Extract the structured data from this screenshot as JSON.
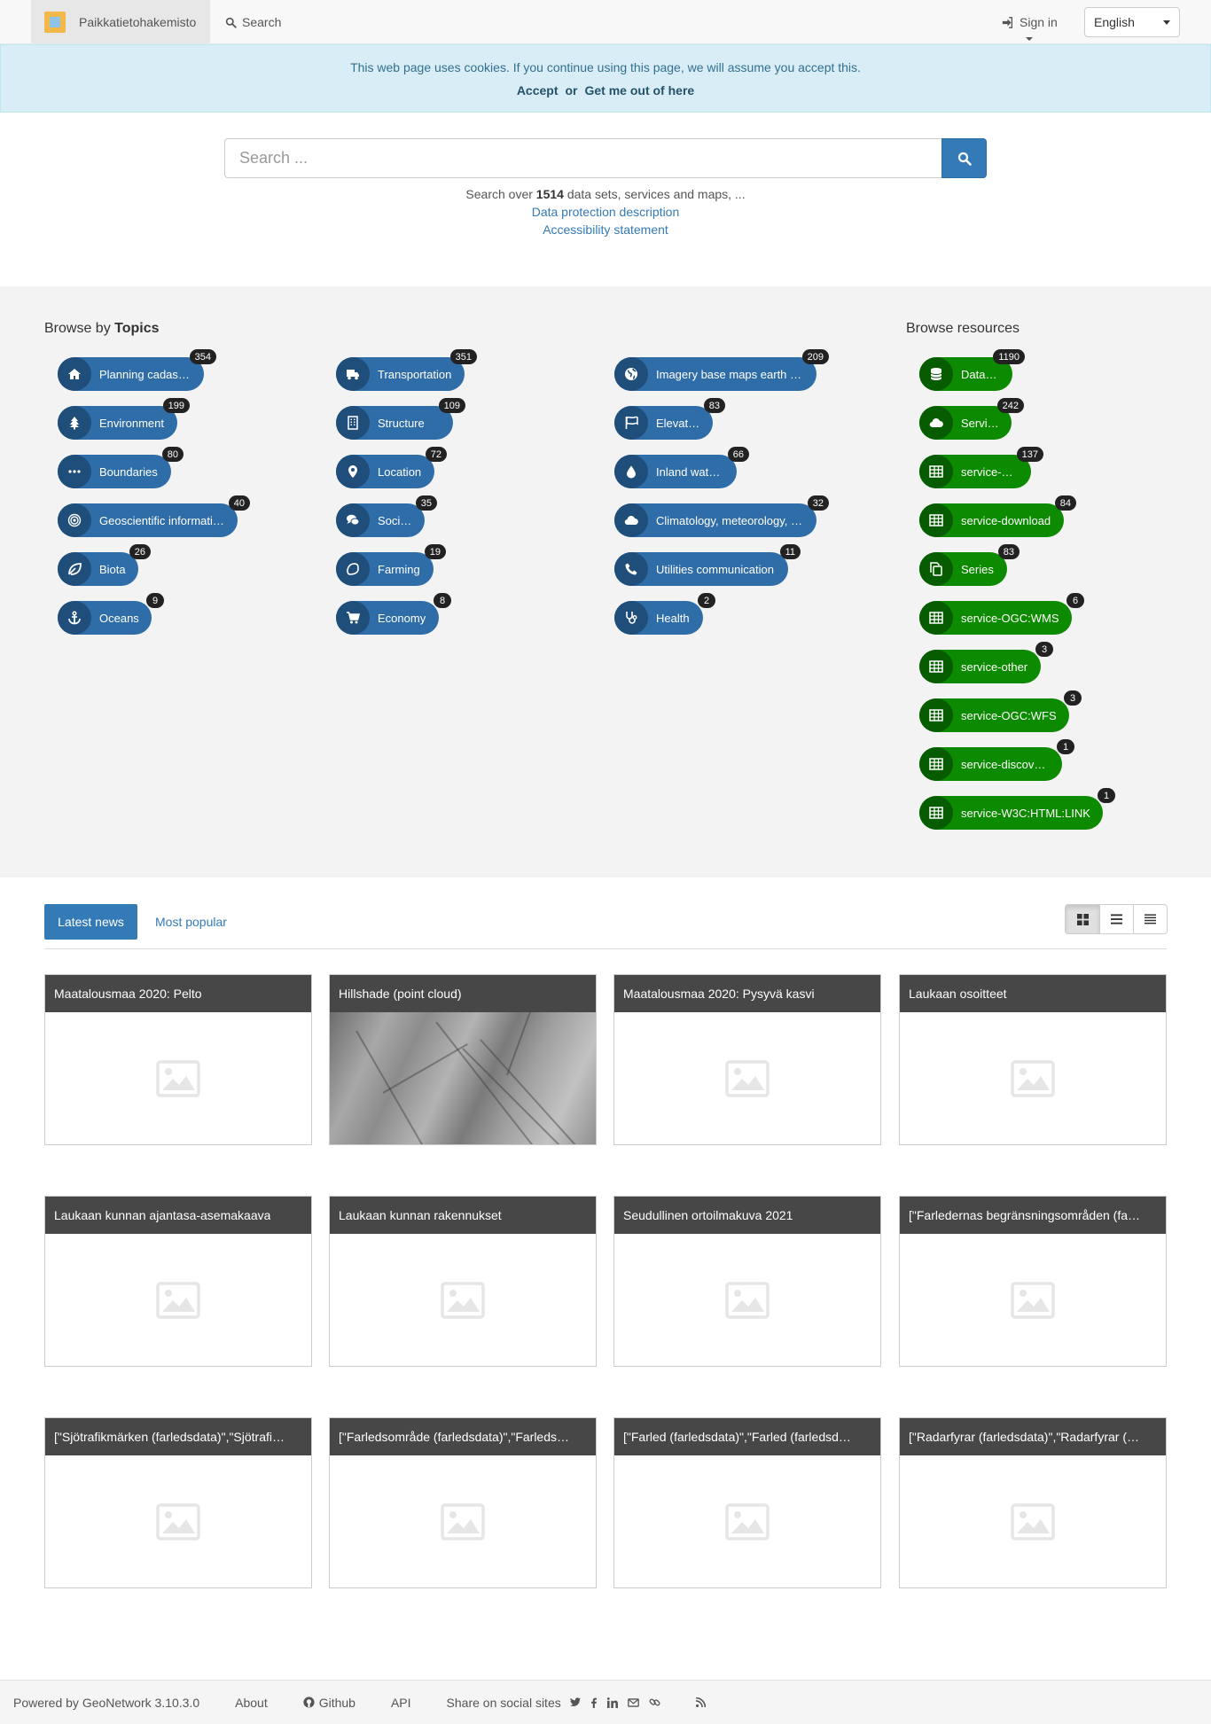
{
  "navbar": {
    "brand": "Paikkatietohakemisto",
    "search_label": "Search",
    "signin_label": "Sign in",
    "language": "English"
  },
  "cookie": {
    "message": "This web page uses cookies. If you continue using this page, we will assume you accept this.",
    "accept": "Accept",
    "or": "or",
    "reject": "Get me out of here"
  },
  "search": {
    "placeholder": "Search ...",
    "info_prefix": "Search over",
    "count": "1514",
    "info_suffix": "data sets, services and maps, ...",
    "data_protection": "Data protection description",
    "accessibility": "Accessibility statement"
  },
  "topics": {
    "title_prefix": "Browse by",
    "title_bold": "Topics",
    "items": [
      {
        "label": "Planning cadastre",
        "count": "354",
        "icon": "home-icon"
      },
      {
        "label": "Environment",
        "count": "199",
        "icon": "tree-icon"
      },
      {
        "label": "Boundaries",
        "count": "80",
        "icon": "ellipsis-icon"
      },
      {
        "label": "Geoscientific information",
        "count": "40",
        "icon": "target-icon"
      },
      {
        "label": "Biota",
        "count": "26",
        "icon": "leaf-icon"
      },
      {
        "label": "Oceans",
        "count": "9",
        "icon": "anchor-icon"
      },
      {
        "label": "Transportation",
        "count": "351",
        "icon": "truck-icon"
      },
      {
        "label": "Structure",
        "count": "109",
        "icon": "building-icon"
      },
      {
        "label": "Location",
        "count": "72",
        "icon": "map-marker-icon"
      },
      {
        "label": "Society",
        "count": "35",
        "icon": "comments-icon"
      },
      {
        "label": "Farming",
        "count": "19",
        "icon": "lemon-icon"
      },
      {
        "label": "Economy",
        "count": "8",
        "icon": "cart-icon"
      },
      {
        "label": "Imagery base maps earth …",
        "count": "209",
        "icon": "globe-icon"
      },
      {
        "label": "Elevation",
        "count": "83",
        "icon": "flag-icon"
      },
      {
        "label": "Inland waters",
        "count": "66",
        "icon": "drop-icon"
      },
      {
        "label": "Climatology, meteorology, …",
        "count": "32",
        "icon": "cloud-icon"
      },
      {
        "label": "Utilities communication",
        "count": "11",
        "icon": "phone-icon"
      },
      {
        "label": "Health",
        "count": "2",
        "icon": "stethoscope-icon"
      }
    ]
  },
  "resources": {
    "title": "Browse resources",
    "items": [
      {
        "label": "Dataset",
        "count": "1190",
        "icon": "database-icon"
      },
      {
        "label": "Service",
        "count": "242",
        "icon": "cloud-icon"
      },
      {
        "label": "service-view",
        "count": "137",
        "icon": "table-icon"
      },
      {
        "label": "service-download",
        "count": "84",
        "icon": "table-icon"
      },
      {
        "label": "Series",
        "count": "83",
        "icon": "copy-icon"
      },
      {
        "label": "service-OGC:WMS",
        "count": "6",
        "icon": "table-icon"
      },
      {
        "label": "service-other",
        "count": "3",
        "icon": "table-icon"
      },
      {
        "label": "service-OGC:WFS",
        "count": "3",
        "icon": "table-icon"
      },
      {
        "label": "service-discovery",
        "count": "1",
        "icon": "table-icon"
      },
      {
        "label": "service-W3C:HTML:LINK",
        "count": "1",
        "icon": "table-icon"
      }
    ]
  },
  "tabs": {
    "latest": "Latest news",
    "popular": "Most popular"
  },
  "cards": [
    {
      "title": "Maatalousmaa 2020: Pelto",
      "image": "placeholder"
    },
    {
      "title": "Hillshade (point cloud)",
      "image": "hillshade"
    },
    {
      "title": "Maatalousmaa 2020: Pysyvä kasvi",
      "image": "placeholder"
    },
    {
      "title": "Laukaan osoitteet",
      "image": "placeholder"
    },
    {
      "title": "Laukaan kunnan ajantasa-asemakaava",
      "image": "placeholder"
    },
    {
      "title": "Laukaan kunnan rakennukset",
      "image": "placeholder"
    },
    {
      "title": "Seudullinen ortoilmakuva 2021",
      "image": "placeholder"
    },
    {
      "title": "[\"Farledernas begränsningsområden (fa…",
      "image": "placeholder"
    },
    {
      "title": "[\"Sjötrafikmärken (farledsdata)\",\"Sjötrafi…",
      "image": "placeholder"
    },
    {
      "title": "[\"Farledsområde (farledsdata)\",\"Farleds…",
      "image": "placeholder"
    },
    {
      "title": "[\"Farled (farledsdata)\",\"Farled (farledsd…",
      "image": "placeholder"
    },
    {
      "title": "[\"Radarfyrar (farledsdata)\",\"Radarfyrar (…",
      "image": "placeholder"
    }
  ],
  "footer": {
    "powered": "Powered by GeoNetwork 3.10.3.0",
    "about": "About",
    "github": "Github",
    "api": "API",
    "share": "Share on social sites"
  },
  "colors": {
    "topic_pill": "#2f6da8",
    "resource_pill": "#0c8a00",
    "primary": "#337ab7",
    "card_header": "#474747"
  }
}
